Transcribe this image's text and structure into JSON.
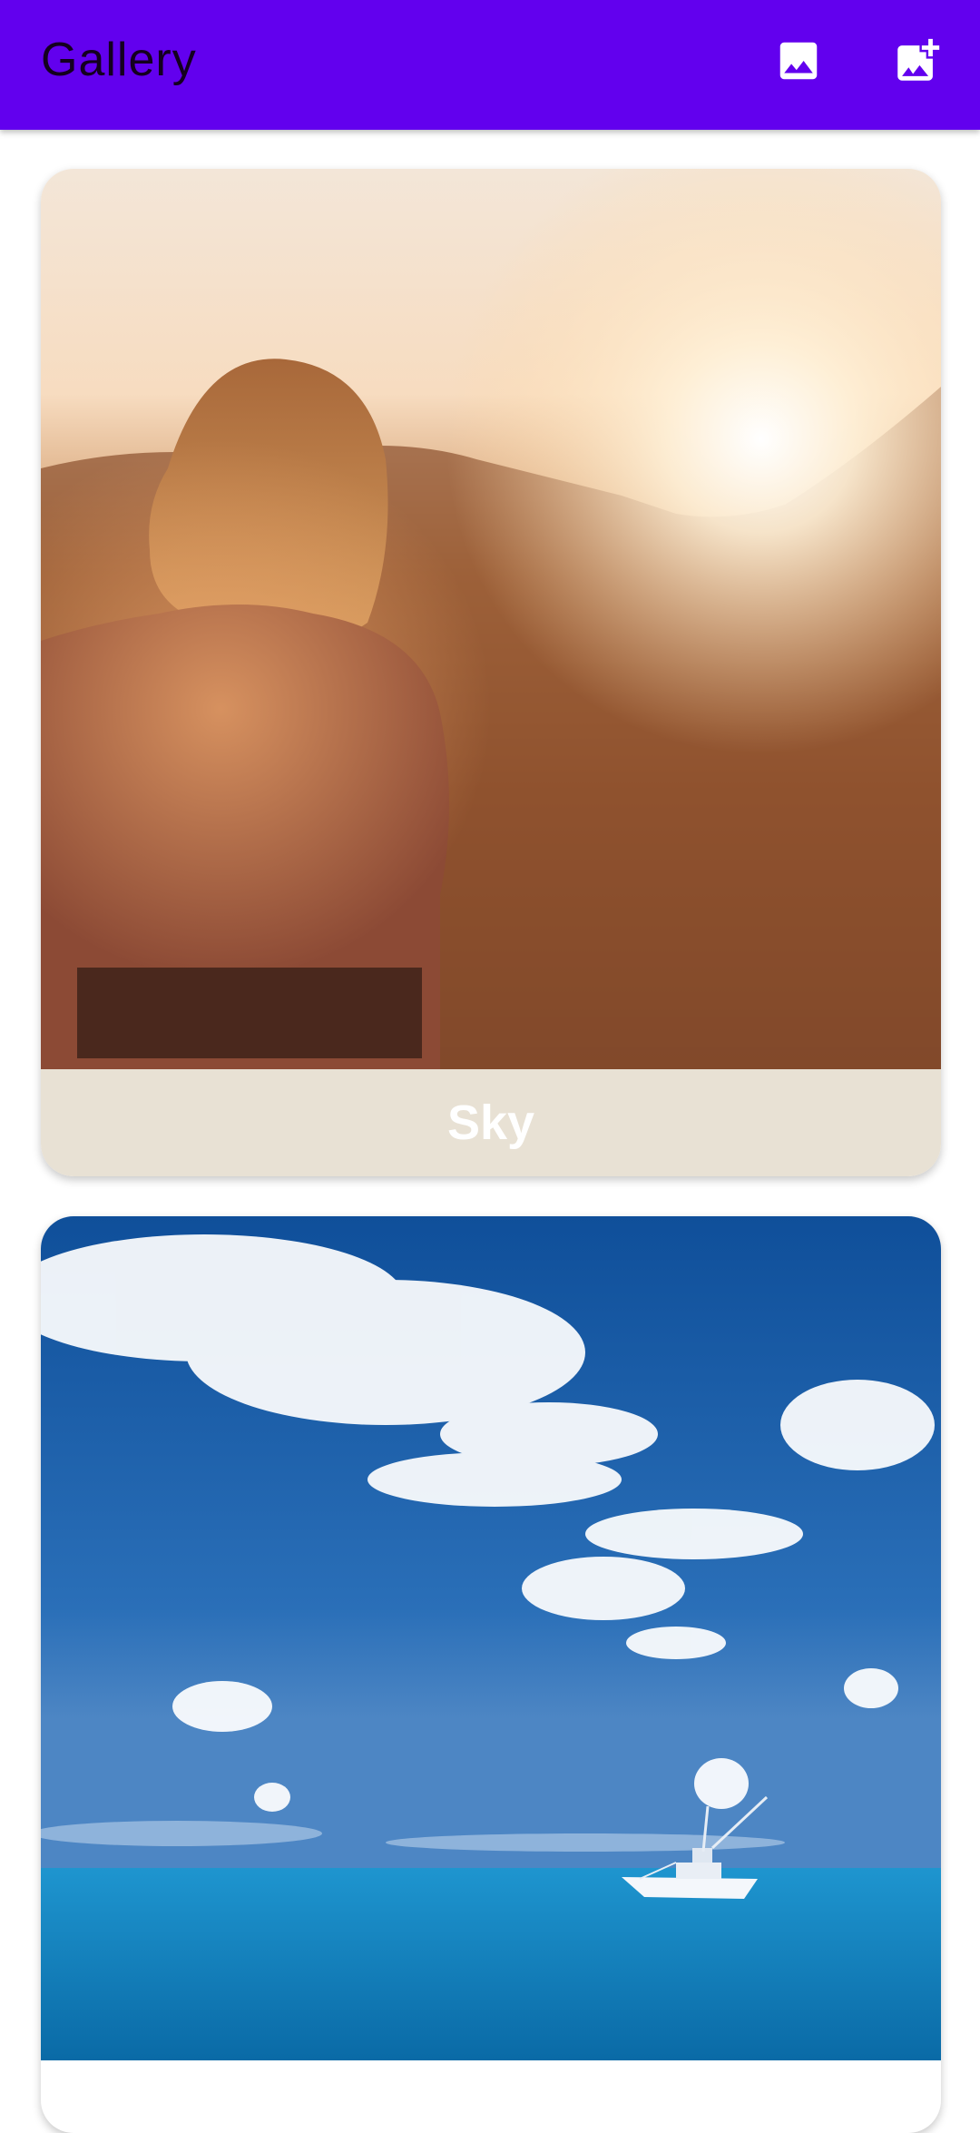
{
  "appbar": {
    "title": "Gallery",
    "color": "#6200ee",
    "actions": [
      {
        "icon": "image-icon"
      },
      {
        "icon": "add-photo-icon"
      }
    ]
  },
  "cards": [
    {
      "caption": "Sky",
      "caption_bg": "#e8e1d4"
    },
    {
      "caption": ""
    }
  ]
}
